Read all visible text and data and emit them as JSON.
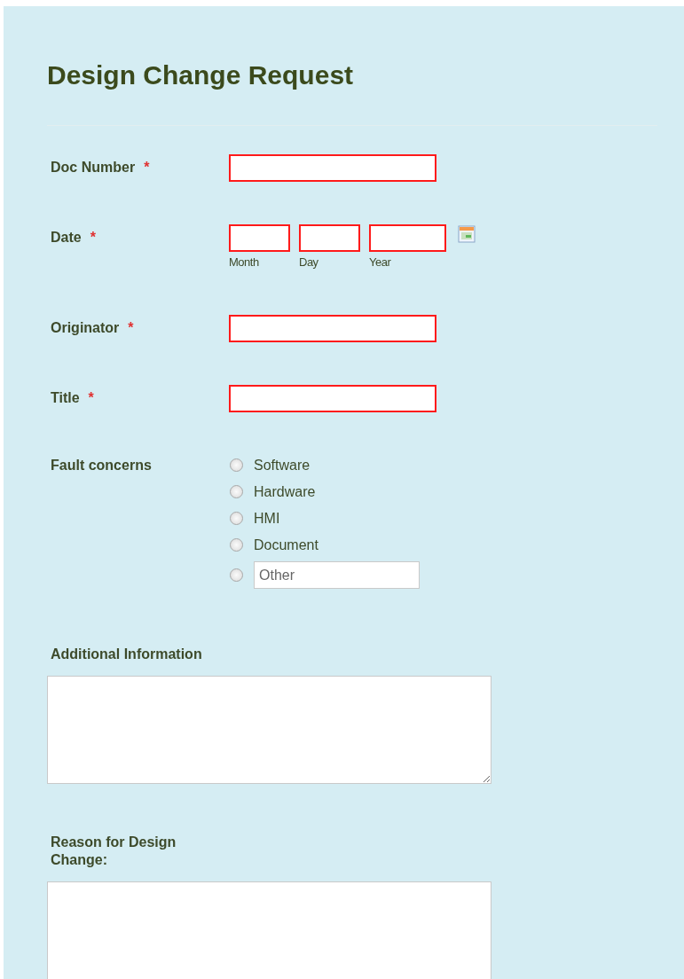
{
  "form": {
    "title": "Design Change Request"
  },
  "fields": [
    {
      "kind": "text",
      "label": "Doc Number",
      "required_mark": "*"
    },
    {
      "kind": "date",
      "label": "Date",
      "required_mark": "*",
      "parts": [
        "Month",
        "Day",
        "Year"
      ]
    },
    {
      "kind": "text",
      "label": "Originator",
      "required_mark": "*"
    },
    {
      "kind": "text",
      "label": "Title",
      "required_mark": "*"
    },
    {
      "kind": "radio",
      "label": "Fault concerns",
      "options": [
        {
          "kind": "option",
          "label": "Software",
          "selected": false
        },
        {
          "kind": "option",
          "label": "Hardware",
          "selected": false
        },
        {
          "kind": "option",
          "label": "HMI",
          "selected": false
        },
        {
          "kind": "option",
          "label": "Document",
          "selected": false
        },
        {
          "kind": "other",
          "placeholder": "Other",
          "selected": false
        }
      ]
    },
    {
      "kind": "textarea",
      "label": "Additional Information"
    },
    {
      "kind": "textarea",
      "label": "Reason for Design Change:"
    }
  ]
}
